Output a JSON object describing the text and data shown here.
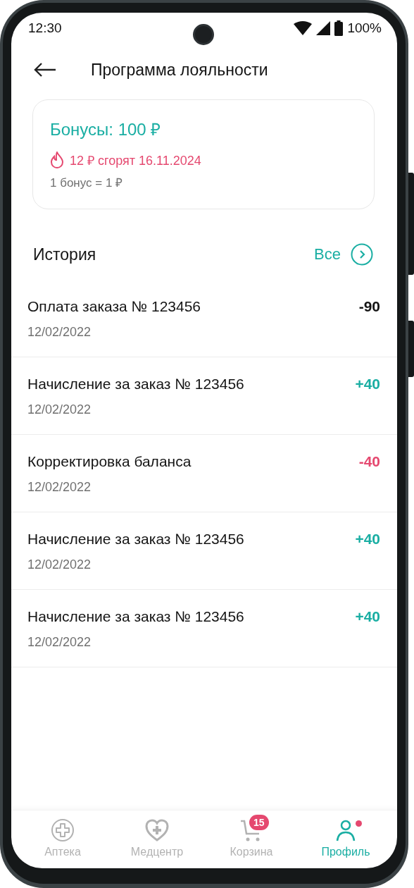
{
  "status_bar": {
    "time": "12:30",
    "battery": "100%"
  },
  "header": {
    "title": "Программа лояльности"
  },
  "bonus_card": {
    "balance": "Бонусы: 100 ₽",
    "expiring": "12 ₽ сгорят 16.11.2024",
    "rate": "1 бонус = 1 ₽"
  },
  "history": {
    "title": "История",
    "all_link": "Все",
    "items": [
      {
        "title": "Оплата заказа № 123456",
        "date": "12/02/2022",
        "amount": "-90",
        "kind": "payment"
      },
      {
        "title": "Начисление за заказ № 123456",
        "date": "12/02/2022",
        "amount": "+40",
        "kind": "accrual"
      },
      {
        "title": "Корректировка баланса",
        "date": "12/02/2022",
        "amount": "-40",
        "kind": "correction"
      },
      {
        "title": "Начисление за заказ № 123456",
        "date": "12/02/2022",
        "amount": "+40",
        "kind": "accrual"
      },
      {
        "title": "Начисление за заказ № 123456",
        "date": "12/02/2022",
        "amount": "+40",
        "kind": "accrual"
      }
    ]
  },
  "bottom_nav": [
    {
      "label": "Аптека",
      "kind": "pharmacy",
      "selected": false,
      "dot": false
    },
    {
      "label": "Медцентр",
      "kind": "medcenter",
      "selected": false,
      "dot": false
    },
    {
      "label": "Корзина",
      "kind": "cart",
      "selected": false,
      "dot": false,
      "badge": "15"
    },
    {
      "label": "Профиль",
      "kind": "profile",
      "selected": true,
      "dot": true
    }
  ]
}
